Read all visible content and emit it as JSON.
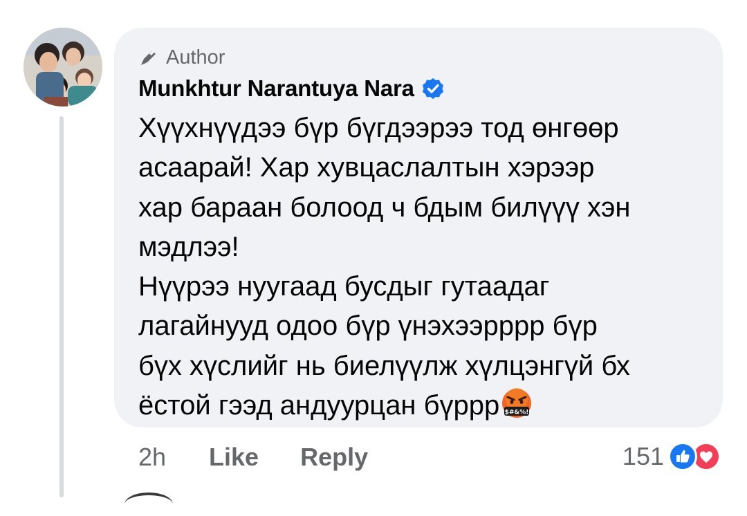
{
  "comment": {
    "author_badge": "Author",
    "author_name": "Munkhtur Narantuya Nara",
    "text_lines": [
      "Хүүхнүүдээ бүр бүгдээрээ тод өнгөөр",
      "асаарай! Хар хувцаслалтын хэрээр",
      "хар бараан болоод ч бдым билүүү хэн",
      "мэдлээ!",
      "Нүүрээ нуугаад бусдыг гутаадаг",
      "лагайнууд одоо бүр үнэхээрррр бүр",
      "бүх хүслийг нь биелүүлж хүлцэнгүй бх",
      "ёстой гээд андуурцан бүррр"
    ],
    "emoji_text": "$#&%!",
    "emoji_name": "face-with-symbols-on-mouth",
    "time": "2h",
    "like_label": "Like",
    "reply_label": "Reply",
    "reaction_count": "151",
    "reaction_icons": [
      "like-reaction-icon",
      "love-reaction-icon"
    ]
  },
  "colors": {
    "bubble_bg": "#f0f2f5",
    "secondary_text": "#65676b",
    "verified_blue": "#1877f2",
    "love_red": "#f33e58"
  }
}
